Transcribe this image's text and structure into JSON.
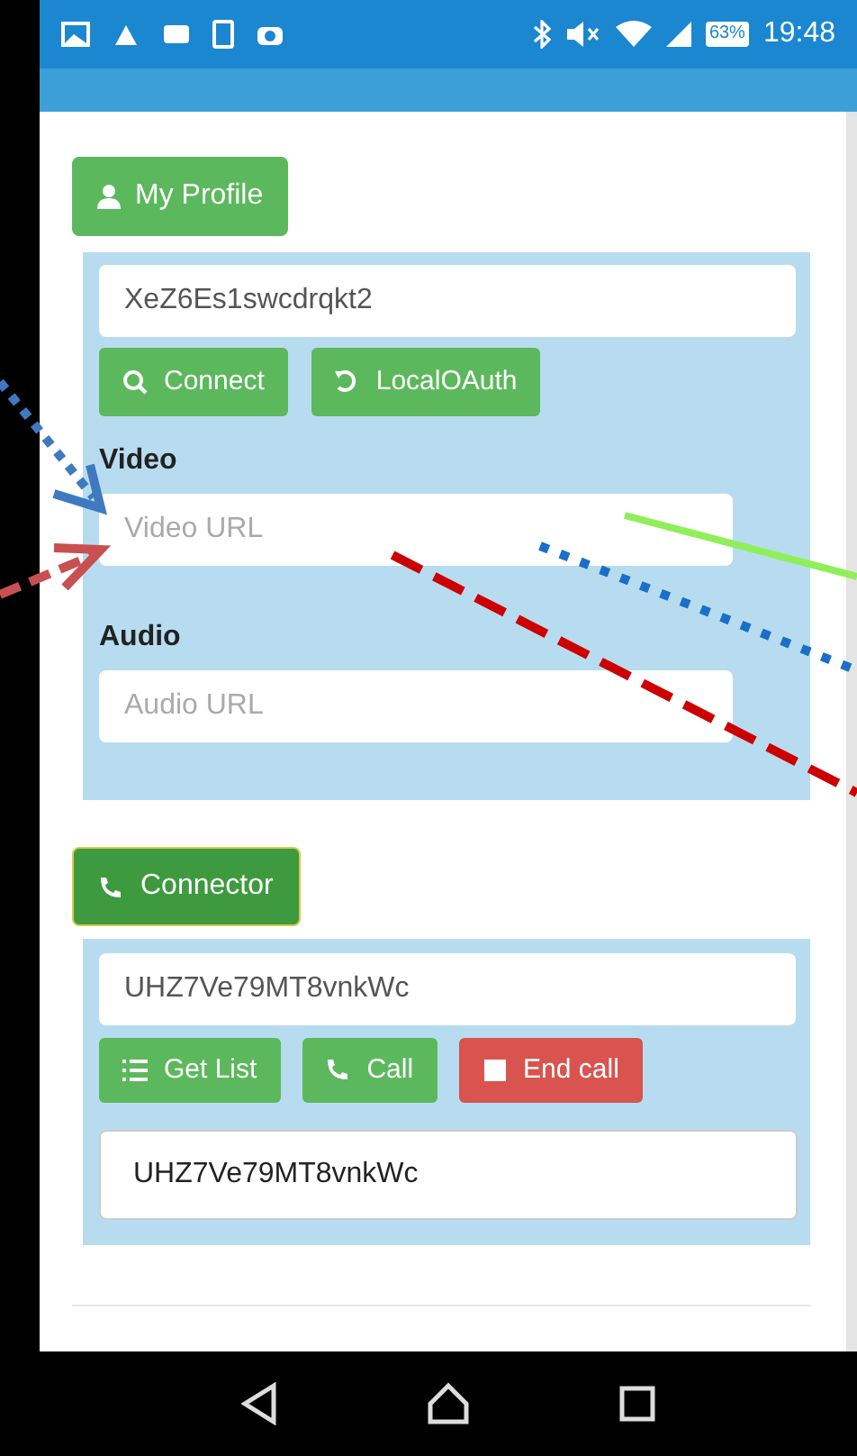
{
  "status_bar": {
    "battery": "63%",
    "time": "19:48"
  },
  "profile": {
    "toggle": "My Profile",
    "id_field": {
      "value": "XeZ6Es1swcdrqkt2"
    },
    "buttons": [
      {
        "kind": "search",
        "label": "Connect"
      },
      {
        "kind": "refresh",
        "label": "LocalOAuth"
      }
    ],
    "video": {
      "label": "Video",
      "placeholder": "Video URL"
    },
    "audio": {
      "label": "Audio",
      "placeholder": "Audio URL"
    }
  },
  "connector": {
    "toggle": "Connector",
    "peer_field": {
      "value": "UHZ7Ve79MT8vnkWc"
    },
    "buttons": [
      {
        "kind": "list",
        "label": "Get List"
      },
      {
        "kind": "call",
        "label": "Call"
      },
      {
        "kind": "end",
        "label": "End call"
      }
    ],
    "output": "UHZ7Ve79MT8vnkWc"
  }
}
